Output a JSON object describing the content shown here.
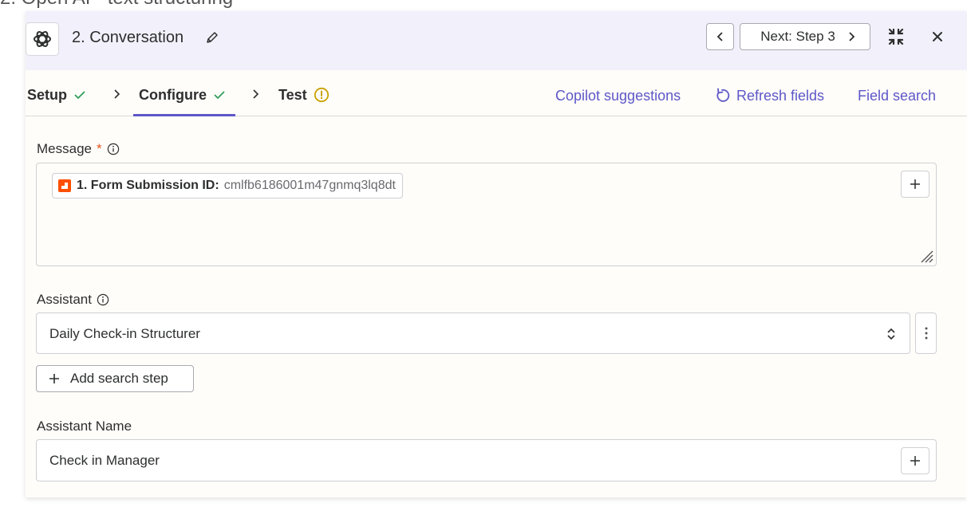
{
  "page_heading": "2. Open AI - text structuring",
  "header": {
    "step_title": "2. Conversation",
    "next_label": "Next: Step 3"
  },
  "tabs": [
    {
      "label": "Setup",
      "status": "complete"
    },
    {
      "label": "Configure",
      "status": "complete",
      "active": true
    },
    {
      "label": "Test",
      "status": "warning"
    }
  ],
  "tab_links": {
    "copilot": "Copilot suggestions",
    "refresh": "Refresh fields",
    "field_search": "Field search"
  },
  "form": {
    "message": {
      "label": "Message",
      "required_mark": "*",
      "pill_key": "1. Form Submission ID:",
      "pill_value": "cmlfb6186001m47gnmq3lq8dt"
    },
    "assistant": {
      "label": "Assistant",
      "value": "Daily Check-in Structurer"
    },
    "add_search_step": "Add search step",
    "assistant_name": {
      "label": "Assistant Name",
      "value": "Check in Manager"
    }
  },
  "colors": {
    "accent": "#5d57c9",
    "check": "#2f9e5b",
    "warning": "#c9a100",
    "required": "#e2521c",
    "pill_icon": "#ff4f00",
    "header_bg": "#f2f1fb"
  },
  "icons": [
    "openai-logo-icon",
    "pencil-icon",
    "chevron-left-icon",
    "chevron-right-icon",
    "collapse-icon",
    "close-icon",
    "check-icon",
    "warning-icon",
    "refresh-icon",
    "info-icon",
    "plus-icon",
    "sort-caret-icon",
    "more-vertical-icon",
    "resize-grip-icon"
  ]
}
